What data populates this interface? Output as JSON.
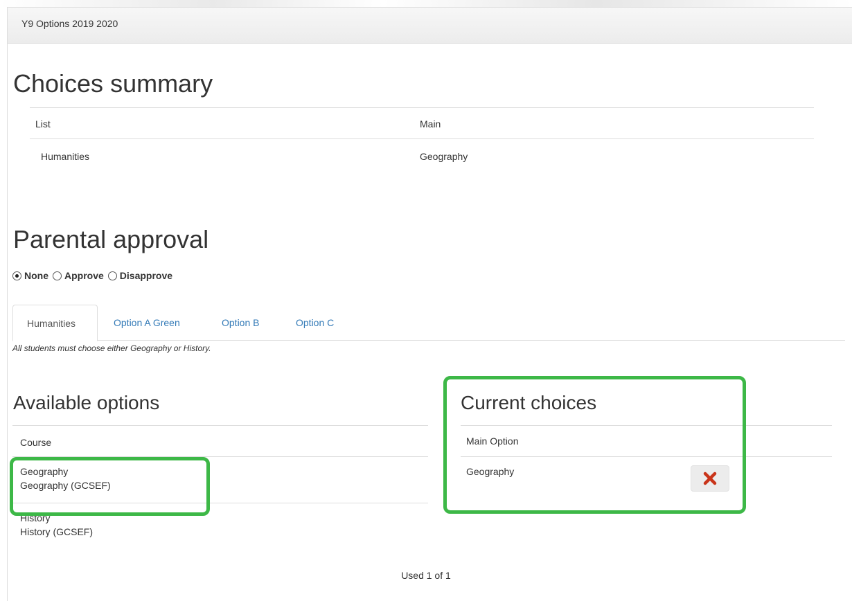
{
  "panel": {
    "title": "Y9 Options 2019 2020"
  },
  "summary": {
    "heading": "Choices summary",
    "columns": [
      "List",
      "Main"
    ],
    "rows": [
      {
        "list": "Humanities",
        "main": "Geography"
      }
    ]
  },
  "approval": {
    "heading": "Parental approval",
    "options": [
      {
        "label": "None",
        "checked": true
      },
      {
        "label": "Approve",
        "checked": false
      },
      {
        "label": "Disapprove",
        "checked": false
      }
    ]
  },
  "tabs": [
    {
      "label": "Humanities",
      "active": true
    },
    {
      "label": "Option A Green",
      "active": false
    },
    {
      "label": "Option B",
      "active": false
    },
    {
      "label": "Option C",
      "active": false
    }
  ],
  "tab_note": "All students must choose either Geography or History.",
  "available": {
    "heading": "Available options",
    "column": "Course",
    "items": [
      {
        "name": "Geography",
        "code": "Geography (GCSEF)"
      },
      {
        "name": "History",
        "code": "History (GCSEF)"
      }
    ]
  },
  "current": {
    "heading": "Current choices",
    "column": "Main Option",
    "items": [
      {
        "name": "Geography",
        "remove_icon": "close-icon"
      }
    ]
  },
  "colors": {
    "highlight": "#3db847",
    "remove_icon": "#c9341a",
    "link": "#337ab7"
  },
  "usage": "Used 1 of 1"
}
